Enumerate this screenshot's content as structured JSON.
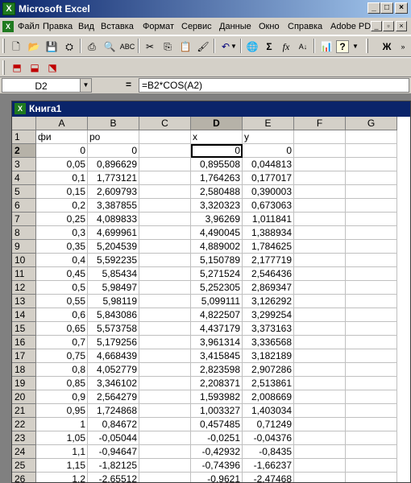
{
  "window": {
    "title": "Microsoft Excel"
  },
  "menu": [
    "Файл",
    "Правка",
    "Вид",
    "Вставка",
    "Формат",
    "Сервис",
    "Данные",
    "Окно",
    "Справка",
    "Adobe PDF"
  ],
  "toolbar": {
    "sigma": "Σ",
    "fx": "fx",
    "zoom_help": "?",
    "bold": "Ж"
  },
  "formula_bar": {
    "name_box": "D2",
    "equals": "=",
    "formula": "=B2*COS(A2)"
  },
  "workbook": {
    "title": "Книга1"
  },
  "sheet": {
    "columns": [
      "A",
      "B",
      "C",
      "D",
      "E",
      "F",
      "G"
    ],
    "header_row": {
      "A": "фи",
      "B": "ро",
      "C": "",
      "D": "x",
      "E": "y"
    },
    "rows": [
      {
        "n": "1",
        "A": "фи",
        "B": "ро",
        "D": "x",
        "E": "y"
      },
      {
        "n": "2",
        "A": "0",
        "B": "0",
        "D": "0",
        "E": "0"
      },
      {
        "n": "3",
        "A": "0,05",
        "B": "0,896629",
        "D": "0,895508",
        "E": "0,044813"
      },
      {
        "n": "4",
        "A": "0,1",
        "B": "1,773121",
        "D": "1,764263",
        "E": "0,177017"
      },
      {
        "n": "5",
        "A": "0,15",
        "B": "2,609793",
        "D": "2,580488",
        "E": "0,390003"
      },
      {
        "n": "6",
        "A": "0,2",
        "B": "3,387855",
        "D": "3,320323",
        "E": "0,673063"
      },
      {
        "n": "7",
        "A": "0,25",
        "B": "4,089833",
        "D": "3,96269",
        "E": "1,011841"
      },
      {
        "n": "8",
        "A": "0,3",
        "B": "4,699961",
        "D": "4,490045",
        "E": "1,388934"
      },
      {
        "n": "9",
        "A": "0,35",
        "B": "5,204539",
        "D": "4,889002",
        "E": "1,784625"
      },
      {
        "n": "10",
        "A": "0,4",
        "B": "5,592235",
        "D": "5,150789",
        "E": "2,177719"
      },
      {
        "n": "11",
        "A": "0,45",
        "B": "5,85434",
        "D": "5,271524",
        "E": "2,546436"
      },
      {
        "n": "12",
        "A": "0,5",
        "B": "5,98497",
        "D": "5,252305",
        "E": "2,869347"
      },
      {
        "n": "13",
        "A": "0,55",
        "B": "5,98119",
        "D": "5,099111",
        "E": "3,126292"
      },
      {
        "n": "14",
        "A": "0,6",
        "B": "5,843086",
        "D": "4,822507",
        "E": "3,299254"
      },
      {
        "n": "15",
        "A": "0,65",
        "B": "5,573758",
        "D": "4,437179",
        "E": "3,373163"
      },
      {
        "n": "16",
        "A": "0,7",
        "B": "5,179256",
        "D": "3,961314",
        "E": "3,336568"
      },
      {
        "n": "17",
        "A": "0,75",
        "B": "4,668439",
        "D": "3,415845",
        "E": "3,182189"
      },
      {
        "n": "18",
        "A": "0,8",
        "B": "4,052779",
        "D": "2,823598",
        "E": "2,907286"
      },
      {
        "n": "19",
        "A": "0,85",
        "B": "3,346102",
        "D": "2,208371",
        "E": "2,513861"
      },
      {
        "n": "20",
        "A": "0,9",
        "B": "2,564279",
        "D": "1,593982",
        "E": "2,008669"
      },
      {
        "n": "21",
        "A": "0,95",
        "B": "1,724868",
        "D": "1,003327",
        "E": "1,403034"
      },
      {
        "n": "22",
        "A": "1",
        "B": "0,84672",
        "D": "0,457485",
        "E": "0,71249"
      },
      {
        "n": "23",
        "A": "1,05",
        "B": "-0,05044",
        "D": "-0,0251",
        "E": "-0,04376"
      },
      {
        "n": "24",
        "A": "1,1",
        "B": "-0,94647",
        "D": "-0,42932",
        "E": "-0,8435"
      },
      {
        "n": "25",
        "A": "1,15",
        "B": "-1,82125",
        "D": "-0,74396",
        "E": "-1,66237"
      },
      {
        "n": "26",
        "A": "1,2",
        "B": "-2,65512",
        "D": "-0,9621",
        "E": "-2,47468"
      }
    ],
    "selected": {
      "col": "D",
      "row": "2"
    }
  }
}
